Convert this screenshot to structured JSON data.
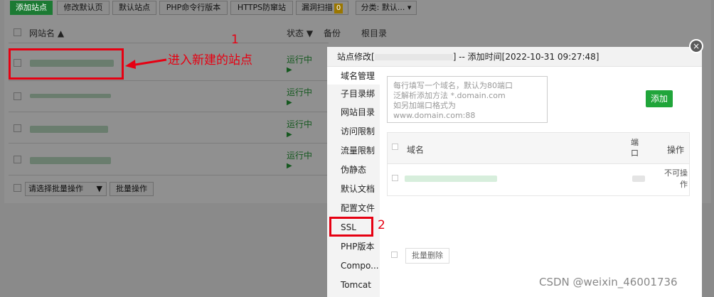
{
  "toolbar": {
    "add_site": "添加站点",
    "edit_default_page": "修改默认页",
    "default_site": "默认站点",
    "php_cli": "PHP命令行版本",
    "https_firewall": "HTTPS防窜站",
    "vuln_scan": "漏洞扫描",
    "vuln_count": "0",
    "category": "分类: 默认..."
  },
  "site_table": {
    "col_site_name": "网站名",
    "col_status": "状态",
    "col_backup": "备份",
    "col_root": "根目录",
    "status_running": "运行中",
    "status_icon": "▶",
    "batch_select_placeholder": "请选择批量操作",
    "batch_button": "批量操作"
  },
  "annotations": {
    "label_1": "1",
    "label_2": "2",
    "arrow_text": "进入新建的站点",
    "color": "#e60012"
  },
  "modal": {
    "title_prefix": "站点修改[",
    "title_suffix": "] -- 添加时间[2022-10-31 09:27:48]",
    "close": "×",
    "menu": [
      "域名管理",
      "子目录绑",
      "网站目录",
      "访问限制",
      "流量限制",
      "伪静态",
      "默认文档",
      "配置文件",
      "SSL",
      "PHP版本",
      "Compo...",
      "Tomcat"
    ],
    "domain_placeholder": "每行填写一个域名，默认为80端口\n泛解析添加方法 *.domain.com\n如另加端口格式为\nwww.domain.com:88",
    "add_button": "添加",
    "col_domain": "域名",
    "col_port": "端\n口",
    "col_action": "操作",
    "row_action": "不可操\n作",
    "batch_delete": "批量删除",
    "accent": "#20a53a"
  },
  "watermark": "CSDN @weixin_46001736"
}
